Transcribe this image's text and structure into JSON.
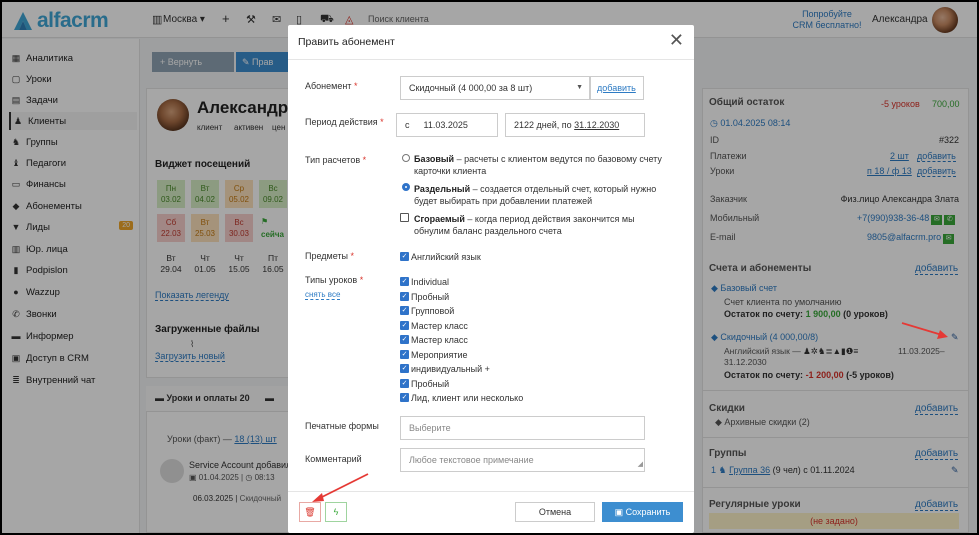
{
  "topbar": {
    "logo": "alfacrm",
    "city": "Москва",
    "search_placeholder": "Поиск клиента",
    "promo_line1": "Попробуйте",
    "promo_line2": "CRM бесплатно!",
    "user_name": "Александра"
  },
  "sidebar": {
    "items": [
      {
        "label": "Аналитика",
        "icon": "chart-icon"
      },
      {
        "label": "Уроки",
        "icon": "lessons-icon"
      },
      {
        "label": "Задачи",
        "icon": "tasks-icon"
      },
      {
        "label": "Клиенты",
        "icon": "person-icon"
      },
      {
        "label": "Группы",
        "icon": "groups-icon"
      },
      {
        "label": "Педагоги",
        "icon": "teacher-icon"
      },
      {
        "label": "Финансы",
        "icon": "money-icon"
      },
      {
        "label": "Абонементы",
        "icon": "tag-icon"
      },
      {
        "label": "Лиды",
        "icon": "funnel-icon",
        "badge": "20"
      },
      {
        "label": "Юр. лица",
        "icon": "building-icon"
      },
      {
        "label": "Podpislon",
        "icon": "doc-icon"
      },
      {
        "label": "Wazzup",
        "icon": "chat-icon"
      },
      {
        "label": "Звонки",
        "icon": "phone-icon"
      },
      {
        "label": "Информер",
        "icon": "informer-icon"
      },
      {
        "label": "Доступ в CRM",
        "icon": "lock-icon"
      },
      {
        "label": "Внутренний чат",
        "icon": "chat-list-icon"
      }
    ]
  },
  "background": {
    "btn_restore": "+ Вернуть",
    "btn_edit": "✎ Прав",
    "client_name": "Александр",
    "tags": [
      "клиент",
      "активен",
      "цен"
    ],
    "widget_title": "Виджет посещений",
    "attendance_row1": [
      {
        "d": "Пн",
        "n": "03.02",
        "c": "g"
      },
      {
        "d": "Вт",
        "n": "04.02",
        "c": "g"
      },
      {
        "d": "Ср",
        "n": "05.02",
        "c": "o"
      },
      {
        "d": "Вс",
        "n": "09.02",
        "c": "g"
      }
    ],
    "attendance_row2": [
      {
        "d": "Сб",
        "n": "22.03",
        "c": "r"
      },
      {
        "d": "Вт",
        "n": "25.03",
        "c": "o"
      },
      {
        "d": "Вс",
        "n": "30.03",
        "c": "r"
      }
    ],
    "today_label": "сейча",
    "dates_row": [
      {
        "d": "Вт",
        "n": "29.04"
      },
      {
        "d": "Чт",
        "n": "01.05"
      },
      {
        "d": "Чт",
        "n": "15.05"
      },
      {
        "d": "Пт",
        "n": "16.05"
      }
    ],
    "show_legend": "Показать легенду",
    "files_title": "Загруженные файлы",
    "upload_new": "Загрузить новый",
    "lessons_tab": "Уроки и оплаты 20",
    "lessons_fact": "Уроки (факт) —",
    "lessons_count": "18 (13) шт",
    "service_account": "Service Account добавил",
    "service_date": "01.04.2025",
    "service_time": "08:13",
    "service_date2": "06.03.2025",
    "service_desc": "Скидочный"
  },
  "right_panel": {
    "total_title": "Общий остаток",
    "total_lessons": "-5 уроков",
    "total_amount": "700,00",
    "date_link": "01.04.2025 08:14",
    "id_label": "ID",
    "id_value": "#322",
    "payments_label": "Платежи",
    "payments_value": "2 шт",
    "payments_add": "добавить",
    "lessons_label": "Уроки",
    "lessons_value": "п 18 / ф 13",
    "lessons_add": "добавить",
    "customer_label": "Заказчик",
    "customer_value": "Физ.лицо Александра Злата",
    "mobile_label": "Мобильный",
    "mobile_value": "+7(990)938-36-48",
    "email_label": "E-mail",
    "email_value": "9805@alfacrm.pro",
    "accounts_title": "Счета и абонементы",
    "accounts_add": "добавить",
    "base_account": "Базовый счет",
    "base_desc": "Счет клиента по умолчанию",
    "base_balance_label": "Остаток по счету:",
    "base_balance": "1 900,00",
    "base_balance_lessons": "(0 уроков)",
    "discount_account": "Скидочный (4 000,00/8)",
    "discount_subject": "Английский язык —",
    "discount_period": "11.03.2025–",
    "discount_period2": "31.12.2030",
    "discount_balance_label": "Остаток по счету:",
    "discount_balance": "-1 200,00",
    "discount_balance_lessons": "(-5 уроков)",
    "discounts_title": "Скидки",
    "discounts_add": "добавить",
    "archive_discounts": "Архивные скидки (2)",
    "groups_title": "Группы",
    "groups_add": "добавить",
    "group_item": "Группа 36",
    "group_item_rest": "(9 чел) с 01.11.2024",
    "group_count": "1",
    "regular_title": "Регулярные уроки",
    "regular_add": "добавить",
    "regular_empty": "(не задано)"
  },
  "modal": {
    "title": "Править абонемент",
    "abonement_label": "Абонемент",
    "abonement_value": "Скидочный (4 000,00 за 8 шт)",
    "abonement_add": "добавить",
    "period_label": "Период действия",
    "period_prefix": "с",
    "period_start": "11.03.2025",
    "period_days": "2122 дней, по",
    "period_end": "31.12.2030",
    "calc_label": "Тип расчетов",
    "calc_base_title": "Базовый",
    "calc_base_desc": "– расчеты с клиентом ведутся по базовому счету",
    "calc_base_desc2": "карточки клиента",
    "calc_sep_title": "Раздельный",
    "calc_sep_desc": "– создается отдельный счет, который нужно",
    "calc_sep_desc2": "будет выбирать при добавлении платежей",
    "calc_burn_title": "Сгораемый",
    "calc_burn_desc": "– когда период действия закончится мы",
    "calc_burn_desc2": "обнулим баланс раздельного счета",
    "subjects_label": "Предметы",
    "subject_value": "Английский язык",
    "lesson_types_label": "Типы уроков",
    "uncheck_all": "снять все",
    "lesson_types": [
      "Individual",
      "Пробный",
      "Групповой",
      "Мастер класс",
      "Мастер класс",
      "Мероприятие",
      "индивидуальный +",
      "Пробный",
      "Лид, клиент или несколько"
    ],
    "print_forms_label": "Печатные формы",
    "print_forms_placeholder": "Выберите",
    "comment_label": "Комментарий",
    "comment_placeholder": "Любое текстовое примечание",
    "cancel_label": "Отмена",
    "save_label": "Сохранить"
  }
}
